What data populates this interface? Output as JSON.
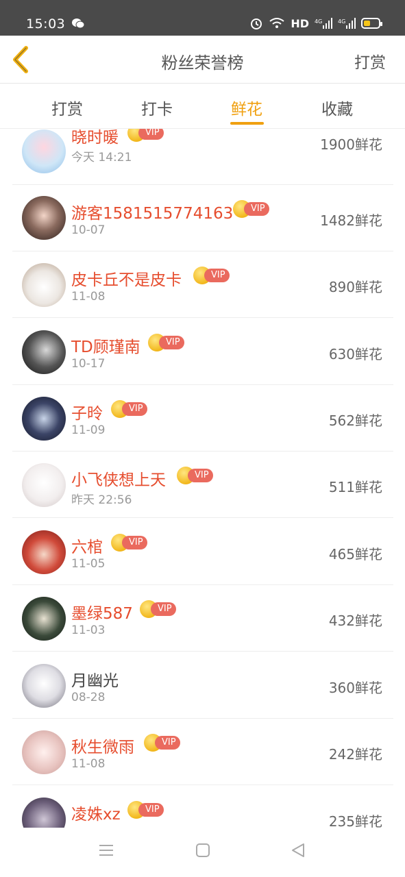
{
  "status_bar": {
    "time": "15:03",
    "network": "HD",
    "icons": [
      "wechat-icon",
      "alarm-icon",
      "wifi-icon",
      "signal-4g-icon",
      "signal-4g-icon",
      "battery-icon"
    ]
  },
  "nav": {
    "title": "粉丝荣誉榜",
    "action": "打赏",
    "back_icon": "chevron-left-icon",
    "back_color": "#f0b010"
  },
  "tabs": [
    {
      "label": "打赏",
      "active": false
    },
    {
      "label": "打卡",
      "active": false
    },
    {
      "label": "鲜花",
      "active": true
    },
    {
      "label": "收藏",
      "active": false
    }
  ],
  "colors": {
    "accent": "#f0a010",
    "vip_name": "#e64d2e",
    "vip_pill": "#ea6a5e"
  },
  "vip_label": "VIP",
  "fans": [
    {
      "name": "晓时暖",
      "vip": true,
      "date": "今天 14:21",
      "amount": "1900鲜花"
    },
    {
      "name": "游客1581515774163",
      "vip": true,
      "date": "10-07",
      "amount": "1482鲜花"
    },
    {
      "name": "皮卡丘不是皮卡",
      "vip": true,
      "date": "11-08",
      "amount": "890鲜花"
    },
    {
      "name": "TD顾瑾南",
      "vip": true,
      "date": "10-17",
      "amount": "630鲜花"
    },
    {
      "name": "子昤",
      "vip": true,
      "date": "11-09",
      "amount": "562鲜花"
    },
    {
      "name": "小飞侠想上天",
      "vip": true,
      "date": "昨天 22:56",
      "amount": "511鲜花"
    },
    {
      "name": "六棺",
      "vip": true,
      "date": "11-05",
      "amount": "465鲜花"
    },
    {
      "name": "墨绿587",
      "vip": true,
      "date": "11-03",
      "amount": "432鲜花"
    },
    {
      "name": "月幽光",
      "vip": false,
      "date": "08-28",
      "amount": "360鲜花"
    },
    {
      "name": "秋生微雨",
      "vip": true,
      "date": "11-08",
      "amount": "242鲜花"
    },
    {
      "name": "凌姝xz",
      "vip": true,
      "date": "",
      "amount": "235鲜花"
    }
  ],
  "system_nav": [
    "menu-icon",
    "home-icon",
    "back-triangle-icon"
  ]
}
